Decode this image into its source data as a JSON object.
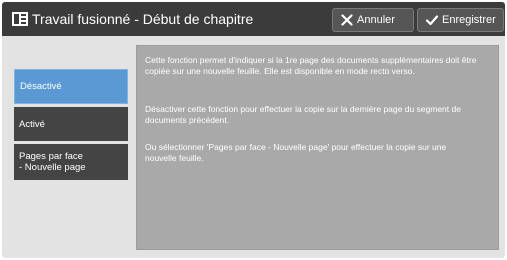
{
  "header": {
    "title": "Travail fusionné - Début de chapitre",
    "title_icon": "document-merge-icon",
    "cancel_label": "Annuler",
    "cancel_icon": "close-icon",
    "save_label": "Enregistrer",
    "save_icon": "checkmark-icon"
  },
  "options": [
    {
      "label": "Désactivé",
      "selected": true
    },
    {
      "label": "Activé",
      "selected": false
    },
    {
      "label": "Pages par face\n- Nouvelle page",
      "selected": false
    }
  ],
  "description": {
    "p1": "Cette fonction permet d'indiquer si la 1re page des documents supplémentaires doit être copiée sur une nouvelle feuille. Elle est disponible en mode recto verso.",
    "p2": "Désactiver cette fonction pour effectuer la copie sur la dernière page du segment de documents précédent.",
    "p3": "Ou sélectionner 'Pages par face - Nouvelle page' pour effectuer la copie sur une nouvelle feuille."
  },
  "colors": {
    "header_bg": "#3b3b3b",
    "selected_option": "#5b99d4",
    "option_bg": "#444444",
    "panel_bg": "#a9a9a9"
  }
}
